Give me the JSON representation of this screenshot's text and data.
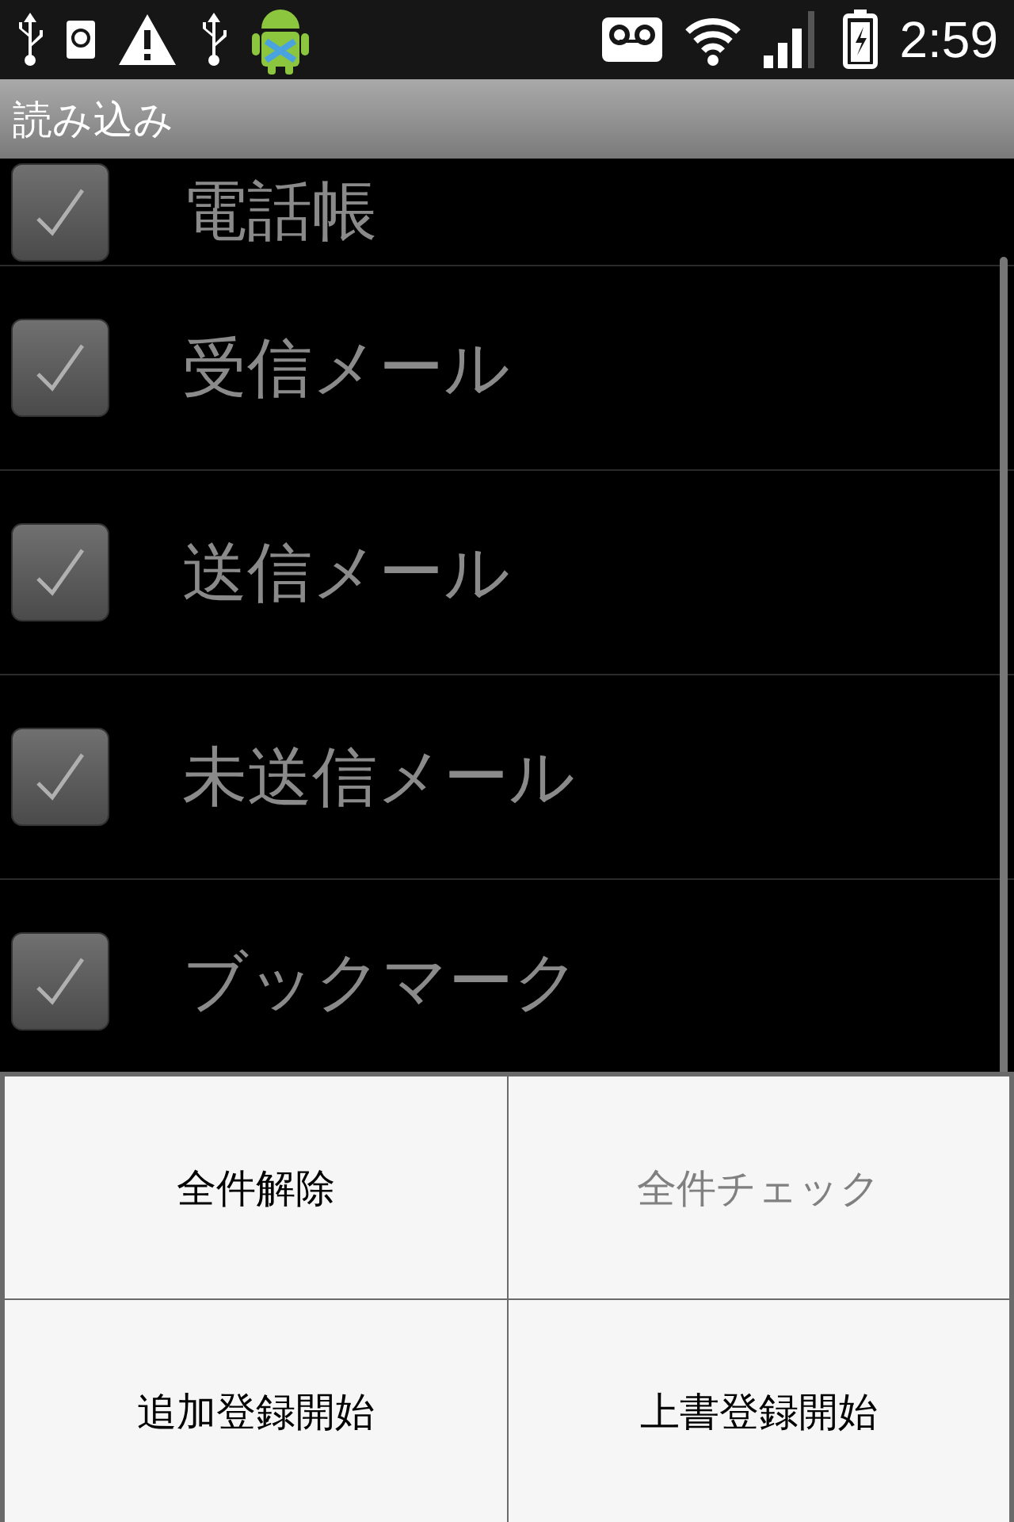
{
  "status_bar": {
    "time": "2:59"
  },
  "title": "読み込み",
  "items": [
    {
      "label": "電話帳",
      "checked": true,
      "disabled": true
    },
    {
      "label": "受信メール",
      "checked": true,
      "disabled": true
    },
    {
      "label": "送信メール",
      "checked": true,
      "disabled": true
    },
    {
      "label": "未送信メール",
      "checked": true,
      "disabled": true
    },
    {
      "label": "ブックマーク",
      "checked": true,
      "disabled": true
    }
  ],
  "menu": [
    {
      "label": "全件解除",
      "disabled": false
    },
    {
      "label": "全件チェック",
      "disabled": true
    },
    {
      "label": "追加登録開始",
      "disabled": false
    },
    {
      "label": "上書登録開始",
      "disabled": false
    }
  ]
}
